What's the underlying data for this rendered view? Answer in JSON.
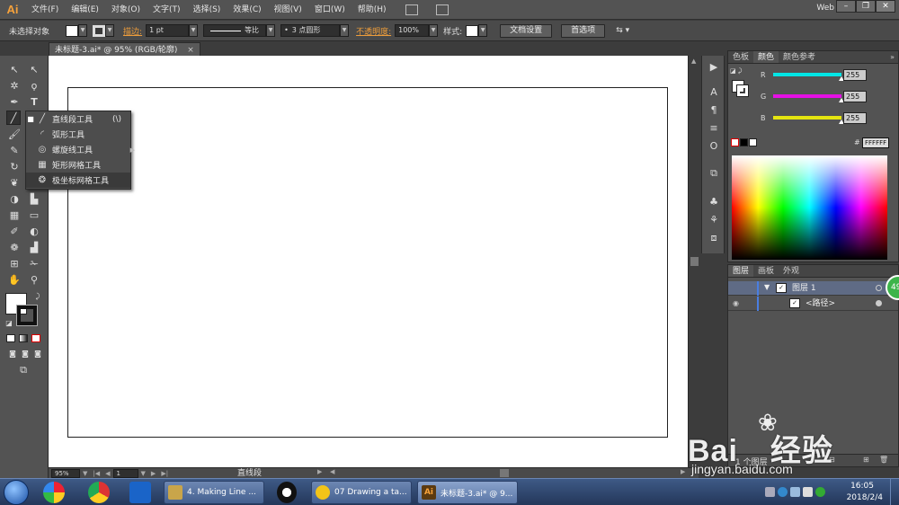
{
  "app": {
    "logo": "Ai",
    "menus": [
      "文件(F)",
      "编辑(E)",
      "对象(O)",
      "文字(T)",
      "选择(S)",
      "效果(C)",
      "视图(V)",
      "窗口(W)",
      "帮助(H)"
    ],
    "workspace": "Web",
    "window_buttons": [
      "–",
      "❐",
      "✕"
    ]
  },
  "controlbar": {
    "selection_status": "未选择对象",
    "stroke_label": "描边:",
    "stroke_weight": "1 pt",
    "profile": "等比",
    "brush": "3 点圆形",
    "opacity_label": "不透明度:",
    "opacity_value": "100%",
    "style_label": "样式:",
    "doc_setup_button": "文档设置",
    "preferences_button": "首选项"
  },
  "document": {
    "tab_title": "未标题-3.ai* @ 95% (RGB/轮廓)",
    "tab_close": "×"
  },
  "flyout": {
    "items": [
      {
        "label": "直线段工具",
        "shortcut": "(\\)",
        "icon": "line-segment-icon",
        "glyph": "╱",
        "bullet": "■"
      },
      {
        "label": "弧形工具",
        "shortcut": "",
        "icon": "arc-icon",
        "glyph": "◜",
        "bullet": ""
      },
      {
        "label": "螺旋线工具",
        "shortcut": "",
        "icon": "spiral-icon",
        "glyph": "◎",
        "bullet": ""
      },
      {
        "label": "矩形网格工具",
        "shortcut": "",
        "icon": "rectangular-grid-icon",
        "glyph": "▦",
        "bullet": ""
      },
      {
        "label": "极坐标网格工具",
        "shortcut": "",
        "icon": "polar-grid-icon",
        "glyph": "❂",
        "bullet": ""
      }
    ]
  },
  "statusbar": {
    "zoom": "95%",
    "artboard_num": "1",
    "current_tool": "直线段"
  },
  "color_panel": {
    "tabs": [
      "色板",
      "颜色",
      "颜色参考"
    ],
    "active_tab": 1,
    "channels": [
      {
        "label": "R",
        "value": "255",
        "color": "#00e5e5"
      },
      {
        "label": "G",
        "value": "255",
        "color": "#e510e5"
      },
      {
        "label": "B",
        "value": "255",
        "color": "#e5e510"
      }
    ],
    "hex_prefix": "#",
    "hex": "FFFFFF"
  },
  "layers_panel": {
    "tabs": [
      "图层",
      "画板",
      "外观"
    ],
    "active_tab": 0,
    "layers": [
      {
        "name": "图层 1",
        "indent": 0
      },
      {
        "name": "<路径>",
        "indent": 1
      }
    ],
    "footer_count": "1 个图层",
    "badge": "49"
  },
  "watermark": {
    "brand": "Bai",
    "brand_cn": "经验",
    "url": "jingyan.baidu.com"
  },
  "taskbar": {
    "tasks": [
      {
        "label": "4. Making Line ...",
        "color": "#c9a54a"
      },
      {
        "label": "07 Drawing a ta...",
        "color": "#f2c418"
      },
      {
        "label": "未标题-3.ai* @ 9...",
        "color": "#5b3a10"
      }
    ],
    "time": "16:05",
    "date": "2018/2/4"
  },
  "colors": {
    "accent_orange": "#f7a23b",
    "canvas": "#ffffff",
    "panel": "#535353"
  }
}
